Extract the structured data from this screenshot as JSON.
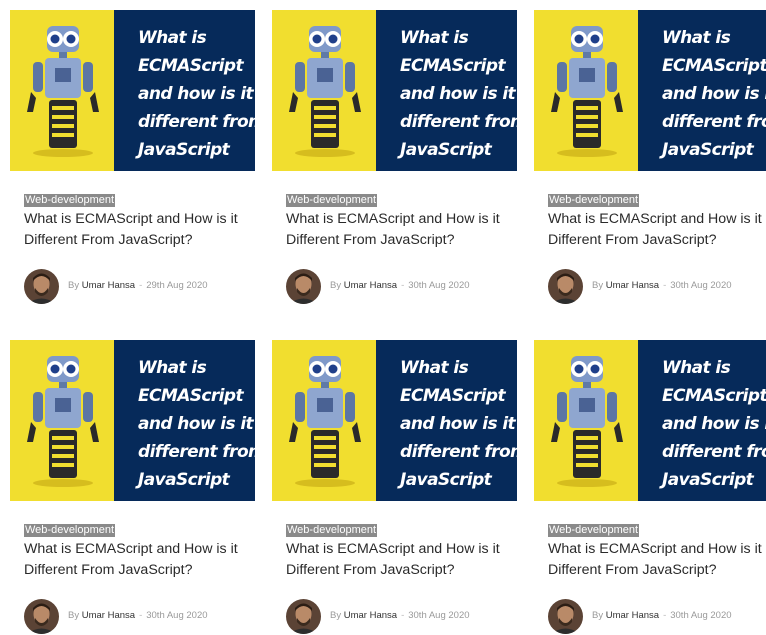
{
  "posts": [
    {
      "thumbnail_text": [
        "What is",
        "ECMAScript",
        "and how is it",
        "different from",
        "JavaScript"
      ],
      "category": "Web-development",
      "title": "What is ECMAScript and How is it Different From JavaScript?",
      "by": "By",
      "author": "Umar Hansa",
      "separator": "-",
      "date": "29th Aug 2020"
    },
    {
      "thumbnail_text": [
        "What is",
        "ECMAScript",
        "and how is it",
        "different from",
        "JavaScript"
      ],
      "category": "Web-development",
      "title": "What is ECMAScript and How is it Different From JavaScript?",
      "by": "By",
      "author": "Umar Hansa",
      "separator": "-",
      "date": "30th Aug 2020"
    },
    {
      "thumbnail_text": [
        "What is",
        "ECMAScript",
        "and how is it",
        "different from",
        "JavaScript"
      ],
      "category": "Web-development",
      "title": "What is ECMAScript and How is it Different From JavaScript?",
      "by": "By",
      "author": "Umar Hansa",
      "separator": "-",
      "date": "30th Aug 2020"
    },
    {
      "thumbnail_text": [
        "What is",
        "ECMAScript",
        "and how is it",
        "different from",
        "JavaScript"
      ],
      "category": "Web-development",
      "title": "What is ECMAScript and How is it Different From JavaScript?",
      "by": "By",
      "author": "Umar Hansa",
      "separator": "-",
      "date": "30th Aug 2020"
    },
    {
      "thumbnail_text": [
        "What is",
        "ECMAScript",
        "and how is it",
        "different from",
        "JavaScript"
      ],
      "category": "Web-development",
      "title": "What is ECMAScript and How is it Different From JavaScript?",
      "by": "By",
      "author": "Umar Hansa",
      "separator": "-",
      "date": "30th Aug 2020"
    },
    {
      "thumbnail_text": [
        "What is",
        "ECMAScript",
        "and how is it",
        "different from",
        "JavaScript"
      ],
      "category": "Web-development",
      "title": "What is ECMAScript and How is it Different From JavaScript?",
      "by": "By",
      "author": "Umar Hansa",
      "separator": "-",
      "date": "30th Aug 2020"
    }
  ],
  "colors": {
    "thumb_yellow": "#f1de2f",
    "thumb_navy": "#062a5a",
    "category_bg": "#8a8a8a"
  },
  "icons": {
    "thumbnail_illustration": "robot-illustration",
    "avatar": "author-avatar"
  }
}
